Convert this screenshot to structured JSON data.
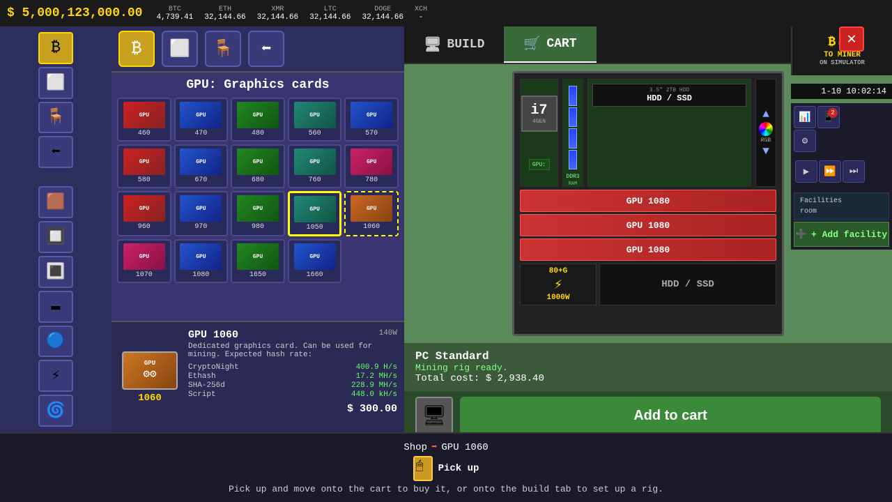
{
  "topbar": {
    "money": "$ 5,000,123,000.00",
    "cryptos": [
      {
        "name": "BTC",
        "value": "4,739.41"
      },
      {
        "name": "ETH",
        "value": "32,144.66"
      },
      {
        "name": "XMR",
        "value": "32,144.66"
      },
      {
        "name": "LTC",
        "value": "32,144.66"
      },
      {
        "name": "DOGE",
        "value": "32,144.66"
      },
      {
        "name": "XCH",
        "value": "-"
      }
    ]
  },
  "shop": {
    "title": "GPU: Graphics cards",
    "gpus": [
      {
        "id": "460",
        "label": "GPU 460",
        "color": "red",
        "fans": "⚙⚙"
      },
      {
        "id": "470",
        "label": "GPU 470",
        "color": "blue",
        "fans": "⚙⚙"
      },
      {
        "id": "480",
        "label": "GPU 480",
        "color": "green",
        "fans": "⚙⚙"
      },
      {
        "id": "560",
        "label": "GPU 560",
        "color": "teal",
        "fans": "⚙⚙"
      },
      {
        "id": "570",
        "label": "GPU 570",
        "color": "blue",
        "fans": "⚙⚙"
      },
      {
        "id": "580",
        "label": "GPU 580",
        "color": "red",
        "fans": "⚙⚙"
      },
      {
        "id": "670",
        "label": "GPU 670",
        "color": "blue",
        "fans": "⚙⚙"
      },
      {
        "id": "680",
        "label": "GPU 680",
        "color": "green",
        "fans": "⚙⚙"
      },
      {
        "id": "760",
        "label": "GPU 760",
        "color": "teal",
        "fans": "⚙⚙"
      },
      {
        "id": "780",
        "label": "GPU 780",
        "color": "pink",
        "fans": "⚙⚙"
      },
      {
        "id": "960",
        "label": "GPU 960",
        "color": "red",
        "fans": "⚙⚙"
      },
      {
        "id": "970",
        "label": "GPU 970",
        "color": "blue",
        "fans": "⚙⚙"
      },
      {
        "id": "980",
        "label": "GPU 980",
        "color": "green",
        "fans": "⚙⚙"
      },
      {
        "id": "1050",
        "label": "GPU 1050",
        "color": "teal",
        "fans": "⚙⚙",
        "selected": true
      },
      {
        "id": "1060",
        "label": "GPU 1060",
        "color": "orange",
        "fans": "⚙⚙",
        "selected": true
      },
      {
        "id": "1070",
        "label": "GPU 1070",
        "color": "pink",
        "fans": "⚙⚙"
      },
      {
        "id": "1080",
        "label": "GPU 1080",
        "color": "blue",
        "fans": "⚙⚙"
      },
      {
        "id": "1650",
        "label": "GPU 1650",
        "color": "green",
        "fans": "⚙⚙"
      },
      {
        "id": "1660",
        "label": "GPU 1660",
        "color": "blue",
        "fans": "⚙⚙"
      }
    ]
  },
  "detail": {
    "name": "GPU 1060",
    "watt": "140W",
    "description": "Dedicated graphics card. Can be used for mining. Expected hash rate:",
    "hashrates": [
      {
        "algo": "CryptoNight",
        "rate": "400.9 H/s"
      },
      {
        "algo": "Ethash",
        "rate": "17.2 MH/s"
      },
      {
        "algo": "SHA-256d",
        "rate": "228.9 MH/s"
      },
      {
        "algo": "Script",
        "rate": "448.0 kH/s"
      }
    ],
    "price": "$ 300.00",
    "label": "1060",
    "gpu_label": "GPU"
  },
  "tabs": {
    "build_label": "BUILD",
    "cart_label": "CART"
  },
  "pc": {
    "cpu": "i7",
    "cpu_gen": "4GEN",
    "ram_type": "DDR3",
    "ram_label": "RAM",
    "gpu_slot_label": "GPU:",
    "hdd_top_label": "3.5\" 2TB HDD",
    "hdd_top_val": "HDD / SSD",
    "gpu_slots": [
      "GPU 1080",
      "GPU 1080",
      "GPU 1080"
    ],
    "psu_label": "80+G",
    "psu_watt": "1000W",
    "hdd_bottom": "HDD / SSD"
  },
  "pc_info": {
    "standard": "PC Standard",
    "mining_ready": "Mining rig ready.",
    "total_cost_label": "Total cost:",
    "total_cost": "$ 2,938.40"
  },
  "buttons": {
    "add_to_cart": "Add to cart"
  },
  "breadcrumb": {
    "shop": "Shop",
    "arrow": "➡",
    "item": "GPU 1060"
  },
  "pickup": {
    "label": "Pick up"
  },
  "hint": {
    "text": "Pick up and move onto the cart to buy it, or onto the build tab to set up a rig."
  },
  "time": {
    "display": "1-10 10:02:14"
  },
  "facility": {
    "add_label": "+ Add facility",
    "rooms": [
      {
        "label": "Facilities"
      },
      {
        "label": "room"
      }
    ]
  },
  "logo": {
    "title": "TO MINER",
    "subtitle": "ON SIMULATOR"
  }
}
